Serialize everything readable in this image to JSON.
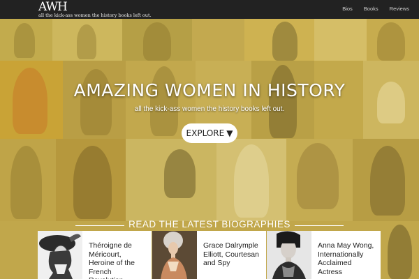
{
  "nav": {
    "logo_mark": "AWH",
    "logo_tagline": "all the kick-ass women the history books left out.",
    "links": [
      "Bios",
      "Books",
      "Reviews"
    ]
  },
  "hero": {
    "title": "AMAZING WOMEN IN HISTORY",
    "subtitle": "all the kick-ass women the history books left out.",
    "button_label": "EXPLORE",
    "button_icon": "▼"
  },
  "biographies": {
    "heading": "READ THE LATEST BIOGRAPHIES",
    "items": [
      {
        "title": "Théroigne de Méricourt, Heroine of the French Revolution",
        "image": "portrait-engraving"
      },
      {
        "title": "Grace Dalrymple Elliott, Courtesan and Spy",
        "image": "portrait-painting"
      },
      {
        "title": "Anna May Wong, Internationally Acclaimed Actress",
        "image": "portrait-photo"
      }
    ]
  },
  "colors": {
    "navbar": "#222222",
    "hero_tint": "#d7bc46",
    "text_light": "#ffffff"
  }
}
